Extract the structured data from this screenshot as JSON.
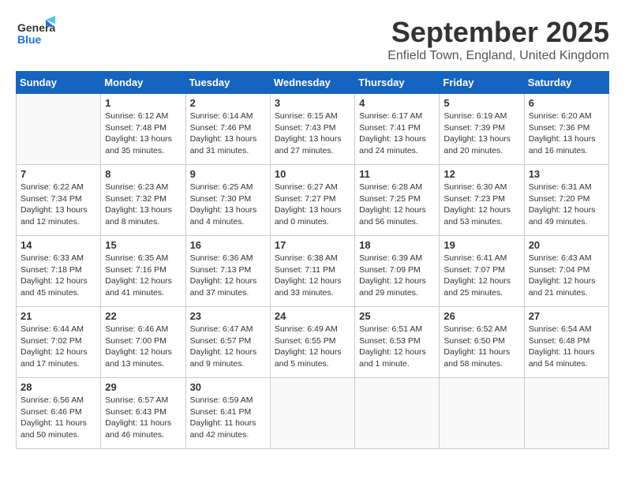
{
  "header": {
    "logo_general": "General",
    "logo_blue": "Blue",
    "month_title": "September 2025",
    "location": "Enfield Town, England, United Kingdom"
  },
  "weekdays": [
    "Sunday",
    "Monday",
    "Tuesday",
    "Wednesday",
    "Thursday",
    "Friday",
    "Saturday"
  ],
  "weeks": [
    [
      {
        "day": "",
        "info": ""
      },
      {
        "day": "1",
        "info": "Sunrise: 6:12 AM\nSunset: 7:48 PM\nDaylight: 13 hours\nand 35 minutes."
      },
      {
        "day": "2",
        "info": "Sunrise: 6:14 AM\nSunset: 7:46 PM\nDaylight: 13 hours\nand 31 minutes."
      },
      {
        "day": "3",
        "info": "Sunrise: 6:15 AM\nSunset: 7:43 PM\nDaylight: 13 hours\nand 27 minutes."
      },
      {
        "day": "4",
        "info": "Sunrise: 6:17 AM\nSunset: 7:41 PM\nDaylight: 13 hours\nand 24 minutes."
      },
      {
        "day": "5",
        "info": "Sunrise: 6:19 AM\nSunset: 7:39 PM\nDaylight: 13 hours\nand 20 minutes."
      },
      {
        "day": "6",
        "info": "Sunrise: 6:20 AM\nSunset: 7:36 PM\nDaylight: 13 hours\nand 16 minutes."
      }
    ],
    [
      {
        "day": "7",
        "info": "Sunrise: 6:22 AM\nSunset: 7:34 PM\nDaylight: 13 hours\nand 12 minutes."
      },
      {
        "day": "8",
        "info": "Sunrise: 6:23 AM\nSunset: 7:32 PM\nDaylight: 13 hours\nand 8 minutes."
      },
      {
        "day": "9",
        "info": "Sunrise: 6:25 AM\nSunset: 7:30 PM\nDaylight: 13 hours\nand 4 minutes."
      },
      {
        "day": "10",
        "info": "Sunrise: 6:27 AM\nSunset: 7:27 PM\nDaylight: 13 hours\nand 0 minutes."
      },
      {
        "day": "11",
        "info": "Sunrise: 6:28 AM\nSunset: 7:25 PM\nDaylight: 12 hours\nand 56 minutes."
      },
      {
        "day": "12",
        "info": "Sunrise: 6:30 AM\nSunset: 7:23 PM\nDaylight: 12 hours\nand 53 minutes."
      },
      {
        "day": "13",
        "info": "Sunrise: 6:31 AM\nSunset: 7:20 PM\nDaylight: 12 hours\nand 49 minutes."
      }
    ],
    [
      {
        "day": "14",
        "info": "Sunrise: 6:33 AM\nSunset: 7:18 PM\nDaylight: 12 hours\nand 45 minutes."
      },
      {
        "day": "15",
        "info": "Sunrise: 6:35 AM\nSunset: 7:16 PM\nDaylight: 12 hours\nand 41 minutes."
      },
      {
        "day": "16",
        "info": "Sunrise: 6:36 AM\nSunset: 7:13 PM\nDaylight: 12 hours\nand 37 minutes."
      },
      {
        "day": "17",
        "info": "Sunrise: 6:38 AM\nSunset: 7:11 PM\nDaylight: 12 hours\nand 33 minutes."
      },
      {
        "day": "18",
        "info": "Sunrise: 6:39 AM\nSunset: 7:09 PM\nDaylight: 12 hours\nand 29 minutes."
      },
      {
        "day": "19",
        "info": "Sunrise: 6:41 AM\nSunset: 7:07 PM\nDaylight: 12 hours\nand 25 minutes."
      },
      {
        "day": "20",
        "info": "Sunrise: 6:43 AM\nSunset: 7:04 PM\nDaylight: 12 hours\nand 21 minutes."
      }
    ],
    [
      {
        "day": "21",
        "info": "Sunrise: 6:44 AM\nSunset: 7:02 PM\nDaylight: 12 hours\nand 17 minutes."
      },
      {
        "day": "22",
        "info": "Sunrise: 6:46 AM\nSunset: 7:00 PM\nDaylight: 12 hours\nand 13 minutes."
      },
      {
        "day": "23",
        "info": "Sunrise: 6:47 AM\nSunset: 6:57 PM\nDaylight: 12 hours\nand 9 minutes."
      },
      {
        "day": "24",
        "info": "Sunrise: 6:49 AM\nSunset: 6:55 PM\nDaylight: 12 hours\nand 5 minutes."
      },
      {
        "day": "25",
        "info": "Sunrise: 6:51 AM\nSunset: 6:53 PM\nDaylight: 12 hours\nand 1 minute."
      },
      {
        "day": "26",
        "info": "Sunrise: 6:52 AM\nSunset: 6:50 PM\nDaylight: 11 hours\nand 58 minutes."
      },
      {
        "day": "27",
        "info": "Sunrise: 6:54 AM\nSunset: 6:48 PM\nDaylight: 11 hours\nand 54 minutes."
      }
    ],
    [
      {
        "day": "28",
        "info": "Sunrise: 6:56 AM\nSunset: 6:46 PM\nDaylight: 11 hours\nand 50 minutes."
      },
      {
        "day": "29",
        "info": "Sunrise: 6:57 AM\nSunset: 6:43 PM\nDaylight: 11 hours\nand 46 minutes."
      },
      {
        "day": "30",
        "info": "Sunrise: 6:59 AM\nSunset: 6:41 PM\nDaylight: 11 hours\nand 42 minutes."
      },
      {
        "day": "",
        "info": ""
      },
      {
        "day": "",
        "info": ""
      },
      {
        "day": "",
        "info": ""
      },
      {
        "day": "",
        "info": ""
      }
    ]
  ]
}
